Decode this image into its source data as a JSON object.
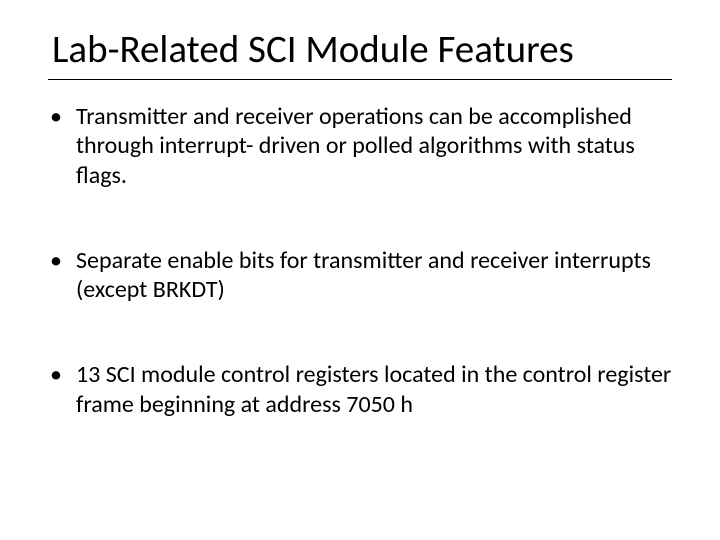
{
  "title": "Lab-Related SCI Module Features",
  "bullets": [
    "Transmitter and receiver operations can be accomplished through interrupt- driven or polled algorithms with status flags.",
    "Separate enable bits for transmitter and receiver interrupts (except BRKDT)",
    "13 SCI module control registers located in the control register frame beginning at address 7050 h"
  ]
}
